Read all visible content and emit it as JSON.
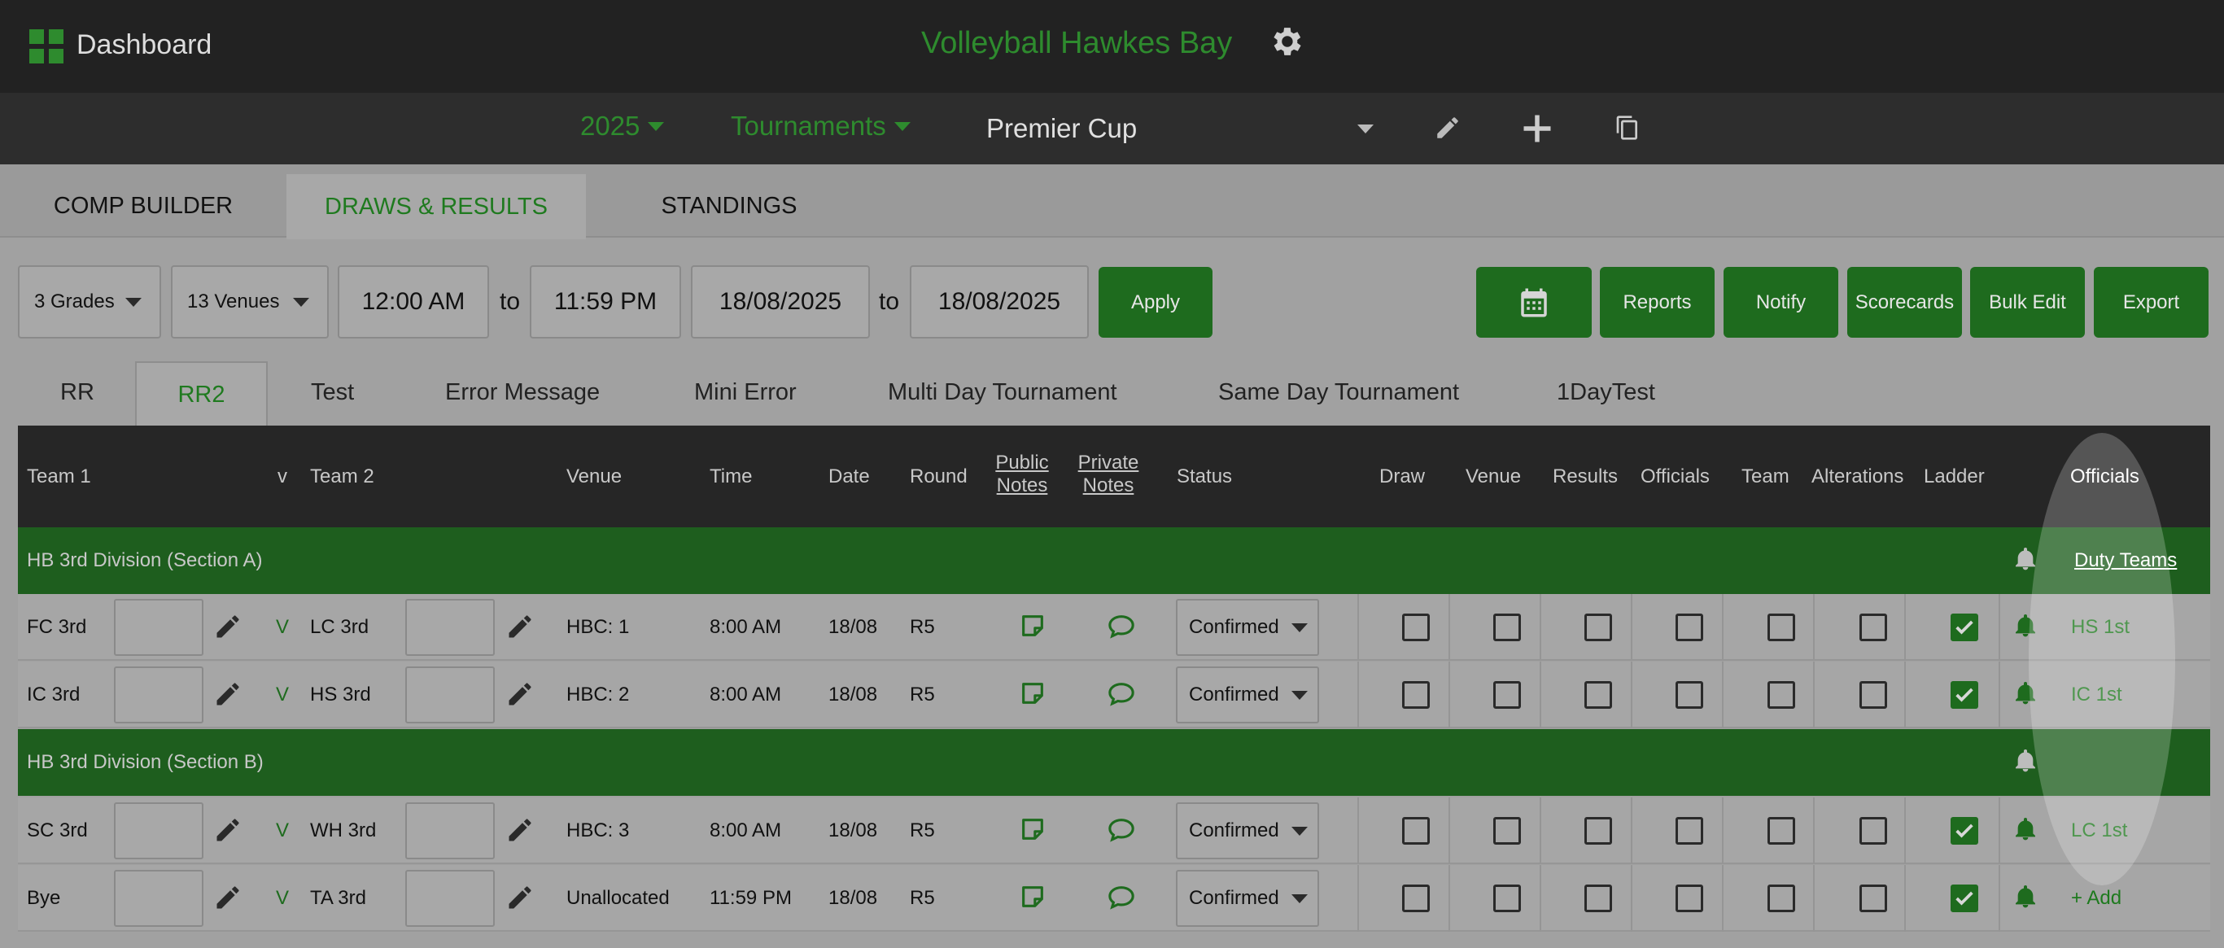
{
  "header": {
    "dashboard_label": "Dashboard",
    "org_title": "Volleyball Hawkes Bay"
  },
  "subbar": {
    "year": "2025",
    "type": "Tournaments",
    "competition": "Premier Cup"
  },
  "main_tabs": [
    {
      "label": "COMP BUILDER"
    },
    {
      "label": "DRAWS & RESULTS"
    },
    {
      "label": "STANDINGS"
    }
  ],
  "filters": {
    "grades": "3 Grades",
    "venues": "13 Venues",
    "time_from": "12:00 AM",
    "time_to": "11:59 PM",
    "to_label": "to",
    "date_from": "18/08/2025",
    "date_to": "18/08/2025",
    "apply_label": "Apply"
  },
  "actions": {
    "reports": "Reports",
    "notify": "Notify",
    "scorecards": "Scorecards",
    "bulk_edit": "Bulk Edit",
    "export": "Export"
  },
  "draw_tabs": [
    {
      "label": "RR"
    },
    {
      "label": "RR2"
    },
    {
      "label": "Test"
    },
    {
      "label": "Error Message"
    },
    {
      "label": "Mini Error"
    },
    {
      "label": "Multi Day Tournament"
    },
    {
      "label": "Same Day Tournament"
    },
    {
      "label": "1DayTest"
    }
  ],
  "columns": {
    "team1": "Team 1",
    "v": "v",
    "team2": "Team 2",
    "venue": "Venue",
    "time": "Time",
    "date": "Date",
    "round": "Round",
    "public_notes_1": "Public",
    "public_notes_2": "Notes",
    "private_notes_1": "Private",
    "private_notes_2": "Notes",
    "status": "Status",
    "draw": "Draw",
    "venue_flag": "Venue",
    "results": "Results",
    "officials_flag": "Officials",
    "team": "Team",
    "alterations": "Alterations",
    "ladder": "Ladder",
    "officials": "Officials"
  },
  "sections": [
    {
      "title": "HB 3rd Division (Section A)",
      "duty_link": "Duty Teams"
    },
    {
      "title": "HB 3rd Division (Section B)",
      "duty_link": ""
    }
  ],
  "rows": [
    {
      "team1": "FC 3rd",
      "v": "V",
      "team2": "LC 3rd",
      "venue": "HBC: 1",
      "time": "8:00 AM",
      "date": "18/08",
      "round": "R5",
      "status": "Confirmed",
      "ladder": true,
      "official": "HS 1st"
    },
    {
      "team1": "IC 3rd",
      "v": "V",
      "team2": "HS 3rd",
      "venue": "HBC: 2",
      "time": "8:00 AM",
      "date": "18/08",
      "round": "R5",
      "status": "Confirmed",
      "ladder": true,
      "official": "IC 1st"
    },
    {
      "team1": "SC 3rd",
      "v": "V",
      "team2": "WH 3rd",
      "venue": "HBC: 3",
      "time": "8:00 AM",
      "date": "18/08",
      "round": "R5",
      "status": "Confirmed",
      "ladder": true,
      "official": "LC 1st"
    },
    {
      "team1": "Bye",
      "v": "V",
      "team2": "TA 3rd",
      "venue": "Unallocated",
      "time": "11:59 PM",
      "date": "18/08",
      "round": "R5",
      "status": "Confirmed",
      "ladder": true,
      "official": "+ Add"
    }
  ],
  "colors": {
    "accent": "#2e8b2e",
    "dark_green": "#1e6b1e",
    "topbar": "#222222"
  },
  "icons": [
    "grid-icon",
    "gear-icon",
    "pencil-icon",
    "plus-icon",
    "copy-icon",
    "calendar-icon",
    "note-icon",
    "comment-icon",
    "bell-icon",
    "check-icon"
  ]
}
